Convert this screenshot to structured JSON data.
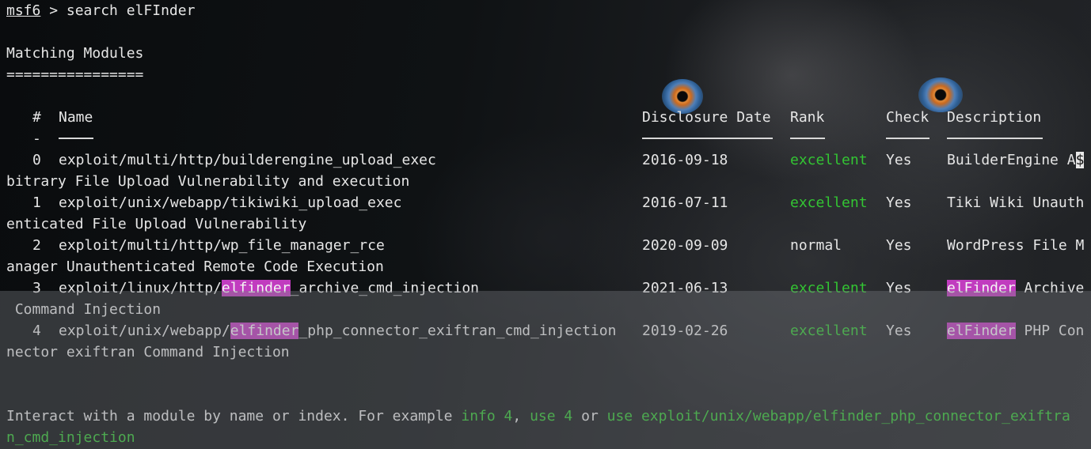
{
  "prompt": {
    "prefix": "msf6",
    "symbol": " > ",
    "command": "search elFInder"
  },
  "section_title": "Matching Modules",
  "section_underline": "================",
  "table": {
    "headers": {
      "num": "#",
      "name": "Name",
      "date": "Disclosure Date",
      "rank": "Rank",
      "check": "Check",
      "description": "Description"
    },
    "dash": "-",
    "rows": [
      {
        "num": "0",
        "name": "exploit/multi/http/builderengine_upload_exec",
        "date": "2016-09-18",
        "rank": "excellent",
        "check": "Yes",
        "desc_start": "BuilderEngine A",
        "desc_cursor": "$",
        "wrap": "bitrary File Upload Vulnerability and execution"
      },
      {
        "num": "1",
        "name": "exploit/unix/webapp/tikiwiki_upload_exec",
        "date": "2016-07-11",
        "rank": "excellent",
        "check": "Yes",
        "desc_start": "Tiki Wiki Unauth",
        "wrap": "enticated File Upload Vulnerability"
      },
      {
        "num": "2",
        "name": "exploit/multi/http/wp_file_manager_rce",
        "date": "2020-09-09",
        "rank": "normal",
        "check": "Yes",
        "desc_start": "WordPress File M",
        "wrap": "anager Unauthenticated Remote Code Execution"
      },
      {
        "num": "3",
        "name_prefix": "exploit/linux/http/",
        "name_match": "elfinder",
        "name_suffix": "_archive_cmd_injection",
        "date": "2021-06-13",
        "rank": "excellent",
        "check": "Yes",
        "desc_match": "elFinder",
        "desc_rest": " Archive",
        "wrap": " Command Injection"
      },
      {
        "num": "4",
        "name_prefix": "exploit/unix/webapp/",
        "name_match": "elfinder",
        "name_suffix": "_php_connector_exiftran_cmd_injection",
        "date": "2019-02-26",
        "rank": "excellent",
        "check": "Yes",
        "desc_match": "elFinder",
        "desc_rest": " PHP Con",
        "wrap": "nector exiftran Command Injection"
      }
    ]
  },
  "footer": {
    "text1": "Interact with a module by name or index. For example ",
    "cmd1": "info 4",
    "sep1": ", ",
    "cmd2": "use 4",
    "sep2": " or ",
    "cmd3_line1": "use exploit/unix/webapp/elfinder_php_connector_exiftra",
    "cmd3_line2": "n_cmd_injection"
  },
  "colors": {
    "green": "#33c533",
    "highlight": "#c13cbf",
    "text": "#e6e6e6"
  }
}
